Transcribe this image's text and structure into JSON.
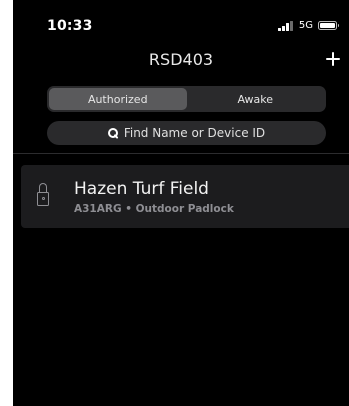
{
  "status_bar": {
    "time": "10:33",
    "network": "5G",
    "signal_bars_active": 3,
    "signal_bars_total": 4,
    "battery_level": 1.0
  },
  "header": {
    "title": "RSD403",
    "add_icon": "plus-icon"
  },
  "tabs": {
    "authorized": "Authorized",
    "awake": "Awake",
    "selected": "Authorized"
  },
  "search": {
    "placeholder": "Find Name or Device ID",
    "icon": "search-icon"
  },
  "devices": [
    {
      "name": "Hazen Turf Field",
      "subtitle": "A31ARG • Outdoor Padlock",
      "icon": "padlock-icon"
    }
  ],
  "colors": {
    "background": "#000000",
    "control_background": "#2a2a2c",
    "segment_active": "#5a5a5c",
    "card_background": "#1c1c1e",
    "secondary_text": "#8e8e93"
  }
}
